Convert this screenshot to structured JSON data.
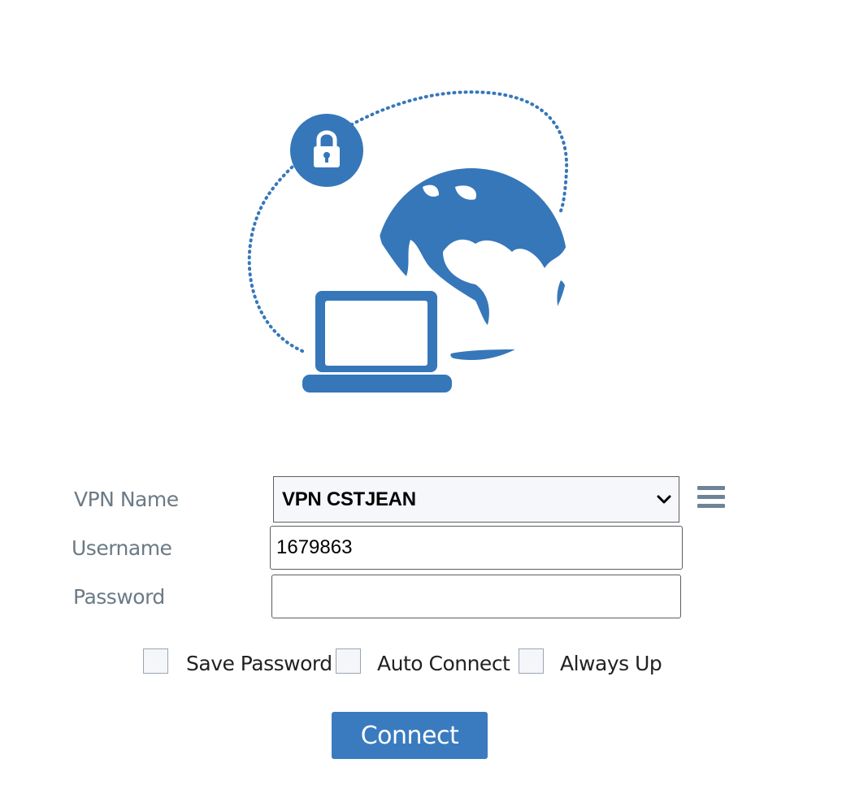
{
  "colors": {
    "brand": "#3a7bbf",
    "illustration": "#3677b9",
    "label_text": "#6b7a85"
  },
  "hero": {
    "icons": [
      "lock-icon",
      "globe-icon",
      "laptop-icon"
    ]
  },
  "form": {
    "vpn_name_label": "VPN Name",
    "vpn_name_selected": "VPN CSTJEAN",
    "username_label": "Username",
    "username_value": "1679863",
    "password_label": "Password",
    "password_value": ""
  },
  "options": {
    "save_password": {
      "label": "Save Password",
      "checked": false
    },
    "auto_connect": {
      "label": "Auto Connect",
      "checked": false
    },
    "always_up": {
      "label": "Always Up",
      "checked": false
    }
  },
  "actions": {
    "connect_label": "Connect",
    "menu_icon": "menu-icon"
  }
}
